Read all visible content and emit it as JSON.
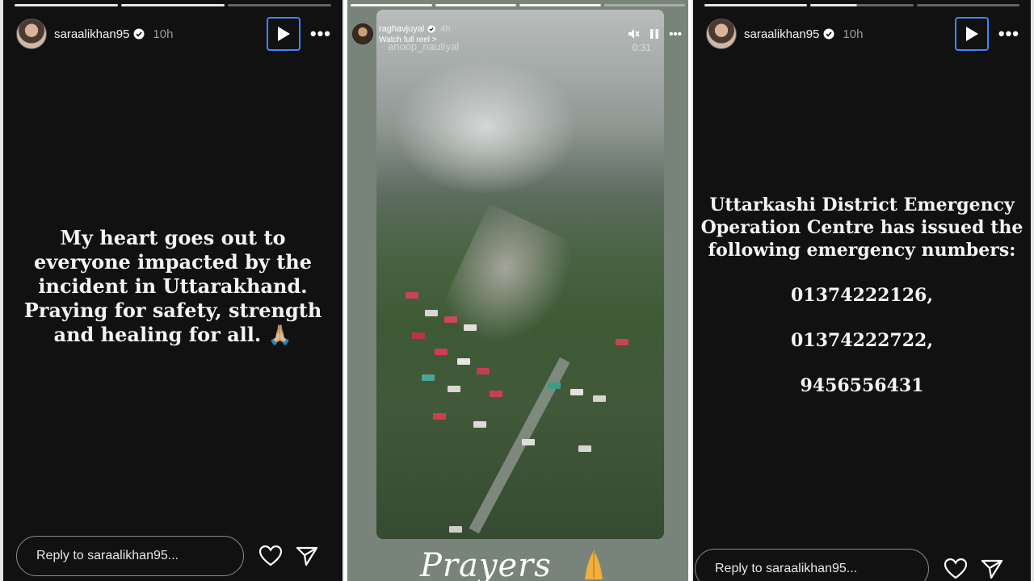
{
  "left_story": {
    "username": "saraalikhan95",
    "time_ago": "10h",
    "message": "My heart goes out to everyone impacted by the incident in Uttarakhand. Praying for safety, strength and healing for all. 🙏🏼",
    "reply_placeholder": "Reply to saraalikhan95...",
    "progress": [
      1,
      1,
      0.05
    ]
  },
  "middle_story": {
    "username": "raghavjuyal",
    "time_ago": "4h",
    "watch_label": "Watch full reel >",
    "overlay_caption": "anoop_nautiyal",
    "timer": "0:31",
    "caption": "Prayers",
    "progress": [
      1,
      1,
      0.9,
      0.1
    ]
  },
  "right_story": {
    "username": "saraalikhan95",
    "time_ago": "10h",
    "heading": "Uttarkashi District Emergency Operation Centre has issued the following emergency numbers:",
    "numbers": [
      "01374222126,",
      "01374222722,",
      "9456556431"
    ],
    "reply_placeholder": "Reply to saraalikhan95...",
    "progress": [
      1,
      0.45,
      0
    ]
  },
  "icons": {
    "play": "play-icon",
    "more": "more-icon",
    "like": "heart-icon",
    "share": "send-icon",
    "mute": "mute-icon",
    "pause": "pause-icon"
  },
  "colors": {
    "story_bg": "#111111",
    "play_border": "#3f86ff",
    "text": "#f4f4f4"
  }
}
